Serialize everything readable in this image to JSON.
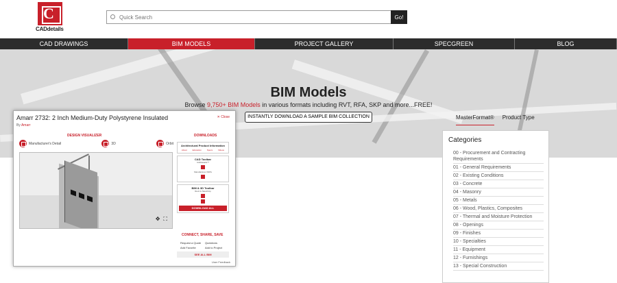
{
  "brand": {
    "logo_letter": "C",
    "name": "CADdetails"
  },
  "search": {
    "placeholder": "Quick Search",
    "button": "Go!"
  },
  "nav": [
    {
      "label": "CAD DRAWINGS",
      "active": false
    },
    {
      "label": "BIM MODELS",
      "active": true
    },
    {
      "label": "PROJECT GALLERY",
      "active": false
    },
    {
      "label": "SPECGREEN",
      "active": false
    },
    {
      "label": "BLOG",
      "active": false
    }
  ],
  "hero": {
    "title": "BIM Models",
    "subtitle_prefix": "Browse ",
    "subtitle_highlight": "9,750+ BIM Models",
    "subtitle_suffix": " in various formats including RVT, RFA, SKP and more...FREE!",
    "button": "INSTANTLY DOWNLOAD A SAMPLE BIM COLLECTION"
  },
  "modal": {
    "title": "Amarr 2732: 2 Inch Medium-Duty Polystyrene Insulated",
    "by_label": "By",
    "by_value": "Amarr",
    "close": "✕ Close",
    "design_visualizer": "DESIGN VISUALIZER",
    "viz_tabs": [
      "Manufacturer's Detail",
      "3D",
      "Orbit"
    ],
    "downloads": "DOWNLOADS",
    "arch_info": "Architectural Product Information",
    "arch_links": [
      "About",
      "Education",
      "Specs",
      "Videos"
    ],
    "cad_toolbar": "CAD Toolbar",
    "cad_format": "CADdetails™",
    "manufacturer_dwg": "Manufacturer DWG",
    "bim_toolbar": "BIM & 3D Toolbar",
    "bim_formats": "Revit & SketchUp",
    "download_all": "DOWNLOAD ALL",
    "connect": "CONNECT, SHARE, SAVE",
    "actions": [
      "Request a Quote",
      "Questions",
      "Add Favorite",
      "Add to Project",
      "Share",
      "(800) 503-XXXX"
    ],
    "see_all_bim": "SEE ALL BIM",
    "feedback": "User Feedback"
  },
  "panel": {
    "tabs": [
      {
        "label": "MasterFormat®",
        "active": true
      },
      {
        "label": "Product Type",
        "active": false
      }
    ],
    "title": "Categories",
    "items": [
      "00 - Procurement and Contracting Requirements",
      "01 - General Requirements",
      "02 - Existing Conditions",
      "03 - Concrete",
      "04 - Masonry",
      "05 - Metals",
      "06 - Wood, Plastics, Composites",
      "07 - Thermal and Moisture Protection",
      "08 - Openings",
      "09 - Finishes",
      "10 - Specialties",
      "11 - Equipment",
      "12 - Furnishings",
      "13 - Special Construction"
    ]
  },
  "colors": {
    "accent": "#c8202a",
    "nav": "#2c2c2c"
  }
}
